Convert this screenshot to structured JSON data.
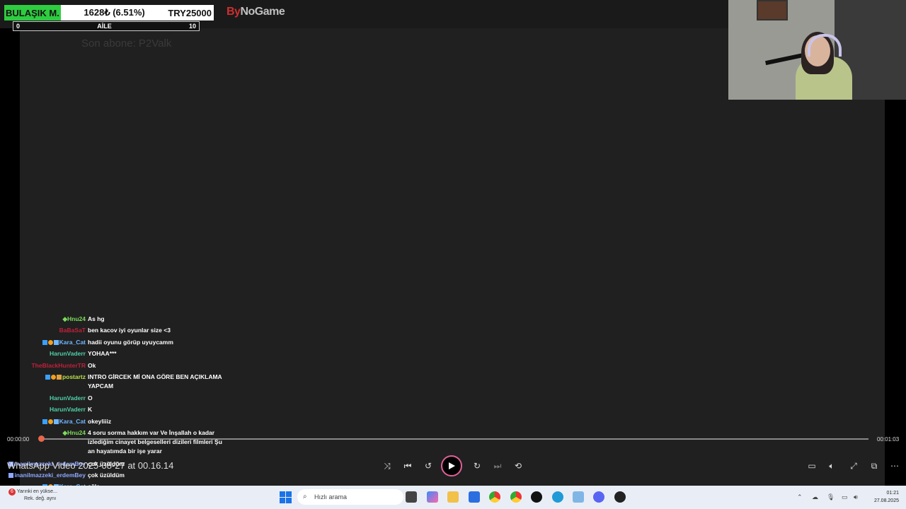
{
  "overlay": {
    "goal": {
      "name": "BULAŞIK M.",
      "amount": "1628₺ (6.51%)",
      "target": "TRY25000",
      "progress_percent": 6.51
    },
    "family_bar": {
      "min": "0",
      "label": "AİLE",
      "max": "10"
    },
    "brand_red": "By",
    "brand_rest": "NoGame",
    "last_subscriber": "Son abone: P2Valk"
  },
  "chat": [
    {
      "user": "Hnu24",
      "color": "#7ddc5a",
      "msg": "As hg",
      "badges": [
        "vip"
      ]
    },
    {
      "user": "BaBaSaT",
      "color": "#c0203a",
      "msg": "ben kacov iyi oyunlar size <3",
      "badges": []
    },
    {
      "user": "Kara_Cat",
      "color": "#6fb7ff",
      "msg": "hadii oyunu görüp uyuycamm",
      "badges": [
        "mod",
        "sub",
        "gift"
      ]
    },
    {
      "user": "HarunVaderr",
      "color": "#4fd0a8",
      "msg": "YOHAA***",
      "badges": []
    },
    {
      "user": "TheBlackHunterTR",
      "color": "#c0203a",
      "msg": "Ok",
      "badges": []
    },
    {
      "user": "postartz",
      "color": "#b6e04a",
      "msg": "INTRO GİRCEK Mİ ONA GÖRE BEN AÇIKLAMA YAPCAM",
      "badges": [
        "mod",
        "sub",
        "gift"
      ]
    },
    {
      "user": "HarunVaderr",
      "color": "#4fd0a8",
      "msg": "O",
      "badges": []
    },
    {
      "user": "HarunVaderr",
      "color": "#4fd0a8",
      "msg": "K",
      "badges": []
    },
    {
      "user": "Kara_Cat",
      "color": "#6fb7ff",
      "msg": "okeyliiiz",
      "badges": [
        "mod",
        "sub",
        "gift"
      ]
    },
    {
      "user": "Hnu24",
      "color": "#7ddc5a",
      "msg": "4 soru sorma hakkım var Ve İnşallah o kadar izlediğim cinayet belgeselleri dizileri filmleri Şu an hayatımda bir işe yarar",
      "badges": [
        "vip"
      ]
    },
    {
      "user": "inanilmazzeki_erdemBey",
      "color": "#8fa8ff",
      "msg": "çok üzüldüm",
      "badges": [
        "sub"
      ]
    },
    {
      "user": "inanilmazzeki_erdemBey",
      "color": "#8fa8ff",
      "msg": "çok üzüldüm",
      "badges": [
        "sub"
      ]
    },
    {
      "user": "Kara_Cat",
      "color": "#6fb7ff",
      "msg": "ağla",
      "badges": [
        "mod",
        "sub",
        "gift"
      ]
    }
  ],
  "player": {
    "current_time": "00:00:00",
    "duration": "00:01:03",
    "title": "WhatsApp Video 2025-08-27 at 00.16.14",
    "progress_fraction": 0.0
  },
  "taskbar": {
    "news_line1": "Yarınki en yükse...",
    "news_line2": "Rek. değ. aynı",
    "news_badge": "6",
    "search_placeholder": "Hızlı arama",
    "time": "01:21",
    "date": "27.08.2025"
  }
}
